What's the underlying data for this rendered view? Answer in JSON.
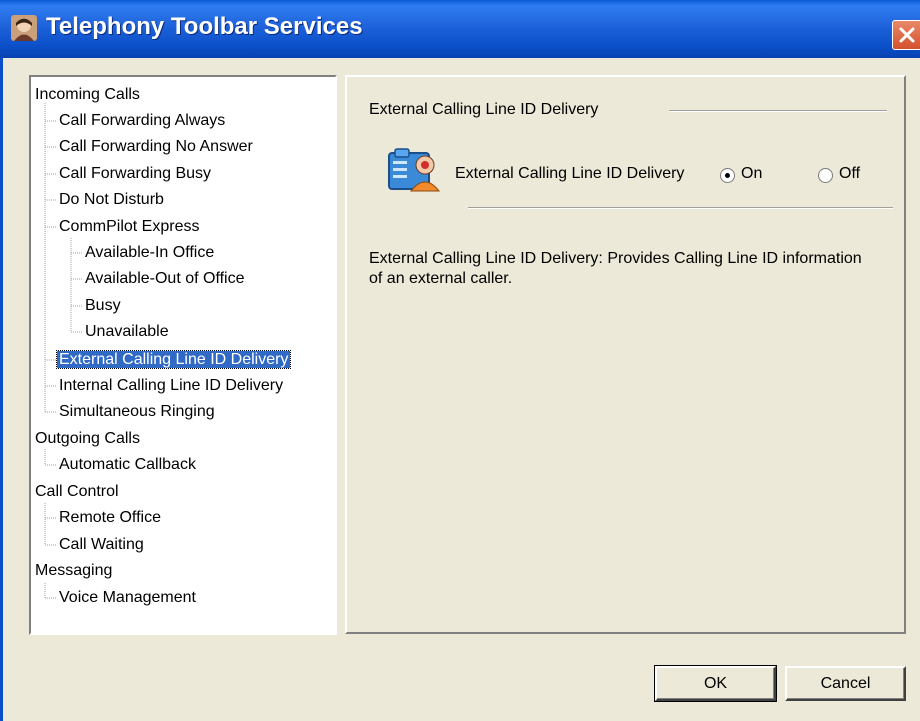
{
  "window": {
    "title": "Telephony Toolbar Services"
  },
  "tree": {
    "items": [
      {
        "label": "Incoming Calls",
        "level": 0
      },
      {
        "label": "Call Forwarding Always",
        "level": 1
      },
      {
        "label": "Call Forwarding No Answer",
        "level": 1
      },
      {
        "label": "Call Forwarding Busy",
        "level": 1
      },
      {
        "label": "Do Not Disturb",
        "level": 1
      },
      {
        "label": "CommPilot Express",
        "level": 1
      },
      {
        "label": "Available-In Office",
        "level": 2
      },
      {
        "label": "Available-Out of Office",
        "level": 2
      },
      {
        "label": "Busy",
        "level": 2
      },
      {
        "label": "Unavailable",
        "level": 2
      },
      {
        "label": "External Calling Line ID Delivery",
        "level": 1,
        "selected": true
      },
      {
        "label": "Internal Calling Line ID Delivery",
        "level": 1
      },
      {
        "label": "Simultaneous Ringing",
        "level": 1
      },
      {
        "label": "Outgoing Calls",
        "level": 0
      },
      {
        "label": "Automatic Callback",
        "level": 1
      },
      {
        "label": "Call Control",
        "level": 0
      },
      {
        "label": "Remote Office",
        "level": 1
      },
      {
        "label": "Call Waiting",
        "level": 1
      },
      {
        "label": "Messaging",
        "level": 0
      },
      {
        "label": "Voice Management",
        "level": 1
      }
    ]
  },
  "panel": {
    "group_title": "External Calling Line ID Delivery",
    "setting_label": "External Calling Line ID Delivery",
    "option_on": "On",
    "option_off": "Off",
    "selected_option": "On",
    "description": "External Calling Line ID Delivery: Provides Calling Line ID information of an external caller."
  },
  "buttons": {
    "ok": "OK",
    "cancel": "Cancel"
  }
}
